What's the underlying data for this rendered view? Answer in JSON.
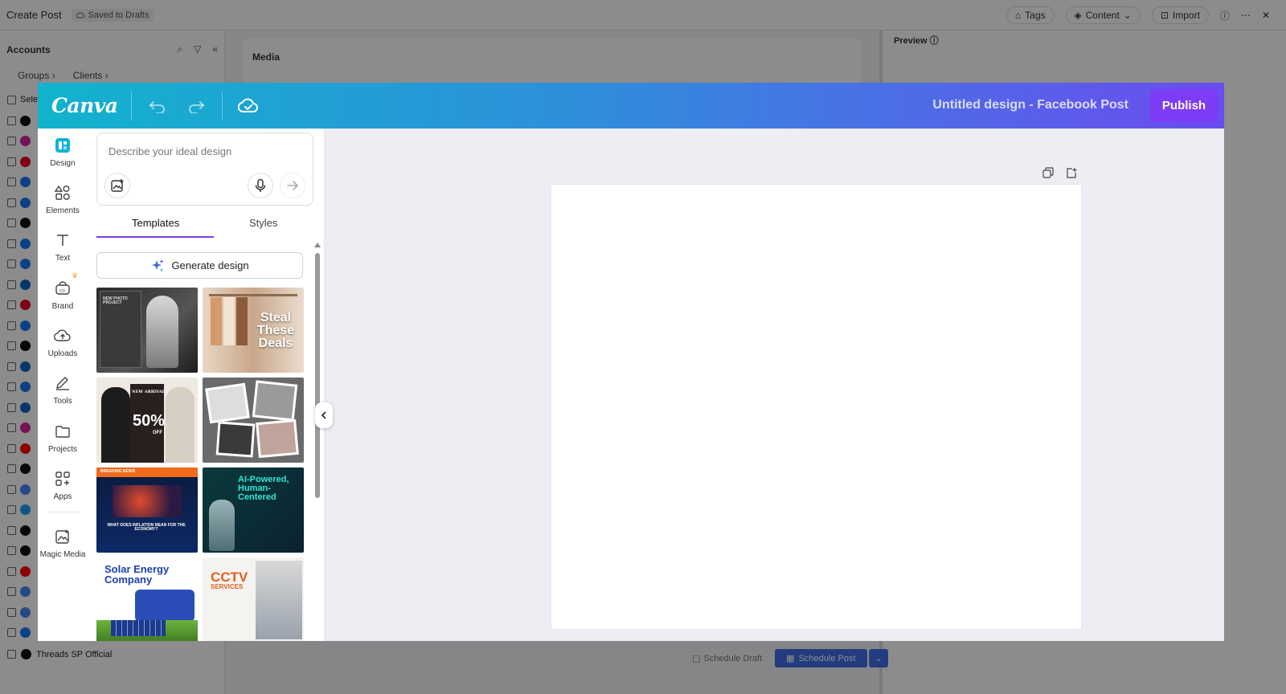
{
  "background_app": {
    "title": "Create Post",
    "saved_status": "Saved to Drafts",
    "top_actions": {
      "tags": "Tags",
      "content": "Content",
      "import": "Import"
    },
    "accounts_heading": "Accounts",
    "filters": {
      "groups": "Groups",
      "clients": "Clients"
    },
    "select_label": "Sele",
    "media_label": "Media",
    "preview_label": "Preview",
    "last_account": "Threads SP Official",
    "schedule_draft": "Schedule Draft",
    "schedule_post": "Schedule Post"
  },
  "canva": {
    "logo": "Canva",
    "design_title": "Untitled design - Facebook Post",
    "publish_label": "Publish",
    "rail": [
      {
        "label": "Design",
        "icon": "design-icon"
      },
      {
        "label": "Elements",
        "icon": "elements-icon"
      },
      {
        "label": "Text",
        "icon": "text-icon"
      },
      {
        "label": "Brand",
        "icon": "brand-icon"
      },
      {
        "label": "Uploads",
        "icon": "uploads-icon"
      },
      {
        "label": "Tools",
        "icon": "tools-icon"
      },
      {
        "label": "Projects",
        "icon": "projects-icon"
      },
      {
        "label": "Apps",
        "icon": "apps-icon"
      },
      {
        "label": "Magic Media",
        "icon": "magic-media-icon"
      }
    ],
    "prompt_placeholder": "Describe your ideal design",
    "tabs": {
      "templates": "Templates",
      "styles": "Styles"
    },
    "generate_label": "Generate design",
    "templates": {
      "t1": "NEW PHOTO PROJECT",
      "t2": "Steal These Deals",
      "t3a": "NEW ARRIVAL",
      "t3b": "50%",
      "t3c": "OFF",
      "t5": "WHAT DOES INFLATION MEAN FOR THE ECONOMY?",
      "t5b": "BREAKING NEWS",
      "t6": "AI-Powered, Human-Centered",
      "t7": "Solar Energy Company",
      "t8a": "CCTV",
      "t8b": "SERVICES"
    }
  }
}
